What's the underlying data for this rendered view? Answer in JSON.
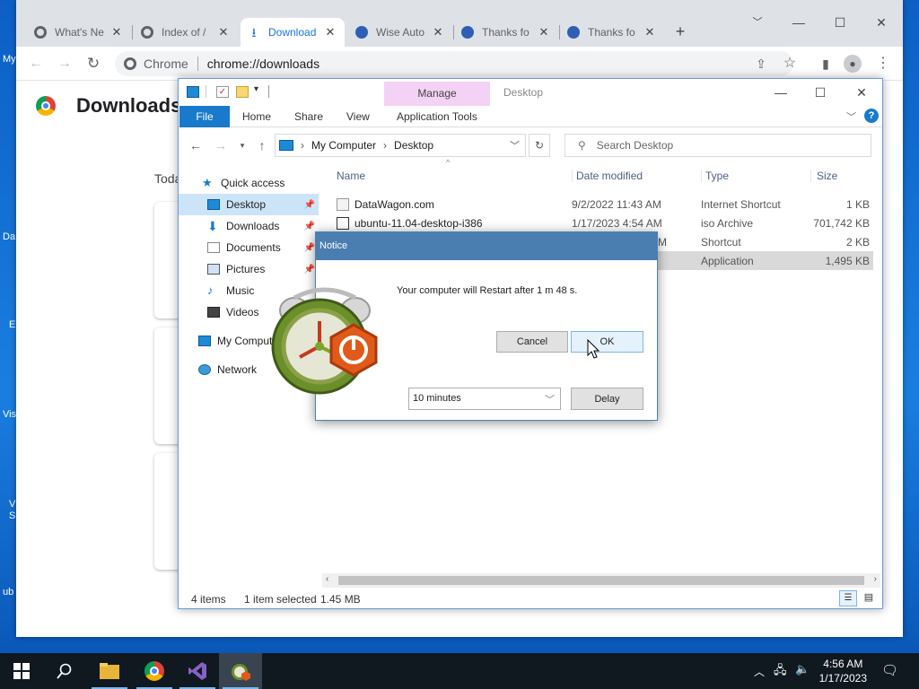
{
  "desktop": {
    "labels": [
      "My",
      "Da",
      "E",
      "Vis",
      "V\nS",
      "ub"
    ]
  },
  "chrome": {
    "tabs": [
      {
        "label": "What's Ne",
        "active": false
      },
      {
        "label": "Index of /",
        "active": false
      },
      {
        "label": "Download",
        "active": true
      },
      {
        "label": "Wise Auto",
        "active": false
      },
      {
        "label": "Thanks fo",
        "active": false
      },
      {
        "label": "Thanks fo",
        "active": false
      }
    ],
    "new_tab": "+",
    "omnibox": {
      "site_label": "Chrome",
      "url": "chrome://downloads"
    },
    "page_title": "Downloads",
    "today_label": "Toda"
  },
  "explorer": {
    "manage_tab": "Manage",
    "title": "Desktop",
    "ribbon_tabs": [
      "File",
      "Home",
      "Share",
      "View",
      "Application Tools"
    ],
    "address": {
      "root": "My Computer",
      "folder": "Desktop"
    },
    "search_placeholder": "Search Desktop",
    "nav": [
      {
        "label": "Quick access",
        "pinned": false,
        "selected": false
      },
      {
        "label": "Desktop",
        "pinned": true,
        "selected": true
      },
      {
        "label": "Downloads",
        "pinned": true,
        "selected": false
      },
      {
        "label": "Documents",
        "pinned": true,
        "selected": false
      },
      {
        "label": "Pictures",
        "pinned": true,
        "selected": false
      },
      {
        "label": "Music",
        "pinned": false,
        "selected": false
      },
      {
        "label": "Videos",
        "pinned": false,
        "selected": false
      },
      {
        "label": "My Comput",
        "pinned": false,
        "selected": false
      },
      {
        "label": "Network",
        "pinned": false,
        "selected": false
      }
    ],
    "columns": [
      "Name",
      "Date modified",
      "Type",
      "Size"
    ],
    "files": [
      {
        "name": "DataWagon.com",
        "date": "9/2/2022 11:43 AM",
        "type": "Internet Shortcut",
        "size": "1 KB",
        "selected": false
      },
      {
        "name": "ubuntu-11.04-desktop-i386",
        "date": "1/17/2023 4:54 AM",
        "type": "iso Archive",
        "size": "701,742 KB",
        "selected": false
      },
      {
        "name": "",
        "date": "M",
        "type": "Shortcut",
        "size": "2 KB",
        "selected": false
      },
      {
        "name": "",
        "date": "",
        "type": "Application",
        "size": "1,495 KB",
        "selected": true
      }
    ],
    "status": {
      "items": "4 items",
      "selected": "1 item selected",
      "size": "1.45 MB"
    }
  },
  "notice": {
    "title": "Notice",
    "message": "Your computer will Restart after 1 m 48 s.",
    "cancel": "Cancel",
    "ok": "OK",
    "delay_value": "10 minutes",
    "delay_button": "Delay"
  },
  "taskbar": {
    "time": "4:56 AM",
    "date": "1/17/2023"
  }
}
